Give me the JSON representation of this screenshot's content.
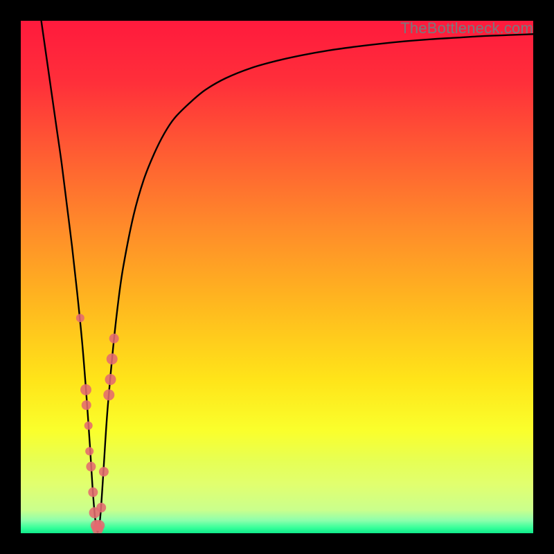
{
  "watermark": "TheBottleneck.com",
  "chart_data": {
    "type": "line",
    "title": "",
    "xlabel": "",
    "ylabel": "",
    "xlim": [
      0,
      100
    ],
    "ylim": [
      0,
      100
    ],
    "grid": false,
    "legend": false,
    "gradient_stops": [
      {
        "offset": 0.0,
        "color": "#ff1a3d"
      },
      {
        "offset": 0.12,
        "color": "#ff2f3a"
      },
      {
        "offset": 0.25,
        "color": "#ff5a33"
      },
      {
        "offset": 0.4,
        "color": "#ff8a2a"
      },
      {
        "offset": 0.55,
        "color": "#ffb71f"
      },
      {
        "offset": 0.7,
        "color": "#ffe419"
      },
      {
        "offset": 0.8,
        "color": "#faff2c"
      },
      {
        "offset": 0.86,
        "color": "#e6ff55"
      },
      {
        "offset": 0.905,
        "color": "#e1ff6f"
      },
      {
        "offset": 0.955,
        "color": "#caff8d"
      },
      {
        "offset": 0.975,
        "color": "#8dffac"
      },
      {
        "offset": 0.99,
        "color": "#33ff99"
      },
      {
        "offset": 1.0,
        "color": "#10e88a"
      }
    ],
    "series": [
      {
        "name": "bottleneck-curve",
        "color": "#000000",
        "x": [
          4,
          5,
          6,
          7,
          8,
          9,
          10,
          11,
          12,
          12.8,
          13.5,
          14,
          14.5,
          14.9,
          15.1,
          15.5,
          16,
          16.5,
          17,
          18,
          19,
          20,
          22,
          24,
          26,
          28,
          30,
          33,
          36,
          40,
          45,
          50,
          55,
          60,
          65,
          70,
          75,
          80,
          85,
          90,
          95,
          100
        ],
        "y": [
          100,
          93,
          86,
          79,
          72,
          64,
          56,
          47,
          37,
          27,
          17,
          9,
          3,
          0.5,
          0.5,
          3,
          10,
          18,
          25,
          36,
          45,
          52,
          62,
          69,
          74,
          78,
          81,
          84,
          86.5,
          88.8,
          90.8,
          92.2,
          93.3,
          94.2,
          94.9,
          95.5,
          96.0,
          96.4,
          96.7,
          97.0,
          97.2,
          97.4
        ]
      }
    ],
    "scatter_points": {
      "name": "highlighted-points",
      "color": "#e46a6f",
      "points": [
        {
          "x": 11.6,
          "y": 42,
          "r": 6
        },
        {
          "x": 12.7,
          "y": 28,
          "r": 8
        },
        {
          "x": 12.8,
          "y": 25,
          "r": 7
        },
        {
          "x": 13.2,
          "y": 21,
          "r": 6
        },
        {
          "x": 13.4,
          "y": 16,
          "r": 6
        },
        {
          "x": 13.7,
          "y": 13,
          "r": 7
        },
        {
          "x": 14.1,
          "y": 8,
          "r": 7
        },
        {
          "x": 14.4,
          "y": 4,
          "r": 8
        },
        {
          "x": 14.7,
          "y": 1.5,
          "r": 8
        },
        {
          "x": 15.0,
          "y": 0.8,
          "r": 8
        },
        {
          "x": 15.3,
          "y": 1.5,
          "r": 8
        },
        {
          "x": 15.7,
          "y": 5,
          "r": 7
        },
        {
          "x": 16.2,
          "y": 12,
          "r": 7
        },
        {
          "x": 17.2,
          "y": 27,
          "r": 8
        },
        {
          "x": 17.5,
          "y": 30,
          "r": 8
        },
        {
          "x": 17.8,
          "y": 34,
          "r": 8
        },
        {
          "x": 18.2,
          "y": 38,
          "r": 7
        }
      ]
    }
  }
}
